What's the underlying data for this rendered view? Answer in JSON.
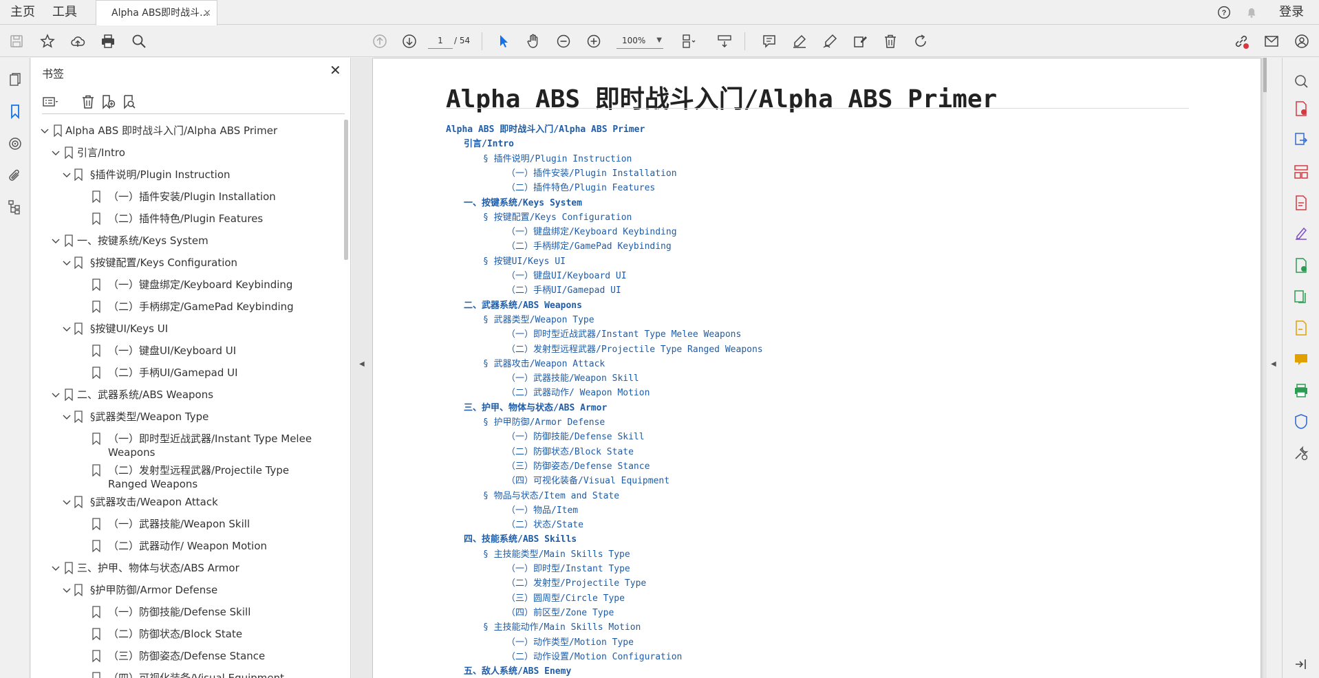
{
  "tabbar": {
    "home": "主页",
    "tools": "工具",
    "doc_tab": "Alpha ABS即时战斗...",
    "close": "×",
    "login": "登录"
  },
  "toolbar": {
    "page_current": "1",
    "page_total": "/ 54",
    "zoom": "100%"
  },
  "icons": {
    "save": "save-icon",
    "bookmark_star": "star-icon",
    "upload": "cloud-upload-icon",
    "print": "print-icon",
    "search": "search-icon",
    "prev_page": "arrow-up-circle-icon",
    "next_page": "arrow-down-circle-icon",
    "select": "cursor-icon",
    "hand": "hand-icon",
    "zoom_out": "zoom-out-icon",
    "zoom_in": "zoom-in-icon"
  },
  "panel": {
    "title": "书签",
    "close": "✕"
  },
  "bookmarks": [
    {
      "label": "Alpha ABS 即时战斗入门/Alpha ABS Primer",
      "level": 0,
      "expand": true
    },
    {
      "label": "引言/Intro",
      "level": 1,
      "expand": true
    },
    {
      "label": "§插件说明/Plugin Instruction",
      "level": 2,
      "expand": true
    },
    {
      "label": "（一）插件安装/Plugin Installation",
      "level": 3,
      "expand": false
    },
    {
      "label": "（二）插件特色/Plugin Features",
      "level": 3,
      "expand": false
    },
    {
      "label": "一、按键系统/Keys System",
      "level": 1,
      "expand": true
    },
    {
      "label": "§按键配置/Keys Configuration",
      "level": 2,
      "expand": true
    },
    {
      "label": "（一）键盘绑定/Keyboard Keybinding",
      "level": 3,
      "expand": false
    },
    {
      "label": "（二）手柄绑定/GamePad Keybinding",
      "level": 3,
      "expand": false
    },
    {
      "label": "§按键UI/Keys UI",
      "level": 2,
      "expand": true
    },
    {
      "label": "（一）键盘UI/Keyboard UI",
      "level": 3,
      "expand": false
    },
    {
      "label": "（二）手柄UI/Gamepad UI",
      "level": 3,
      "expand": false
    },
    {
      "label": "二、武器系统/ABS Weapons",
      "level": 1,
      "expand": true
    },
    {
      "label": "§武器类型/Weapon Type",
      "level": 2,
      "expand": true
    },
    {
      "label": "（一）即时型近战武器/Instant Type Melee Weapons",
      "level": 3,
      "expand": false
    },
    {
      "label": "（二）发射型远程武器/Projectile Type Ranged Weapons",
      "level": 3,
      "expand": false
    },
    {
      "label": "§武器攻击/Weapon Attack",
      "level": 2,
      "expand": true
    },
    {
      "label": "（一）武器技能/Weapon Skill",
      "level": 3,
      "expand": false
    },
    {
      "label": "（二）武器动作/ Weapon Motion",
      "level": 3,
      "expand": false
    },
    {
      "label": "三、护甲、物体与状态/ABS Armor",
      "level": 1,
      "expand": true
    },
    {
      "label": "§护甲防御/Armor Defense",
      "level": 2,
      "expand": true
    },
    {
      "label": "（一）防御技能/Defense Skill",
      "level": 3,
      "expand": false
    },
    {
      "label": "（二）防御状态/Block State",
      "level": 3,
      "expand": false
    },
    {
      "label": "（三）防御姿态/Defense Stance",
      "level": 3,
      "expand": false
    },
    {
      "label": "（四）可视化装备/Visual Equipment",
      "level": 3,
      "expand": false
    }
  ],
  "document": {
    "title": "Alpha ABS 即时战斗入门/Alpha ABS Primer",
    "toc": [
      {
        "text": "Alpha ABS 即时战斗入门/Alpha ABS Primer",
        "indent": 0,
        "bold": true
      },
      {
        "text": "引言/Intro",
        "indent": 1,
        "bold": true
      },
      {
        "text": "§ 插件说明/Plugin Instruction",
        "indent": 2,
        "bold": false
      },
      {
        "text": "（一）插件安装/Plugin Installation",
        "indent": 3,
        "bold": false
      },
      {
        "text": "（二）插件特色/Plugin Features",
        "indent": 3,
        "bold": false
      },
      {
        "text": "一、按键系统/Keys System",
        "indent": 1,
        "bold": true
      },
      {
        "text": "§ 按键配置/Keys Configuration",
        "indent": 2,
        "bold": false
      },
      {
        "text": "（一）键盘绑定/Keyboard Keybinding",
        "indent": 3,
        "bold": false
      },
      {
        "text": "（二）手柄绑定/GamePad Keybinding",
        "indent": 3,
        "bold": false
      },
      {
        "text": "§ 按键UI/Keys UI",
        "indent": 2,
        "bold": false
      },
      {
        "text": "（一）键盘UI/Keyboard UI",
        "indent": 3,
        "bold": false
      },
      {
        "text": "（二）手柄UI/Gamepad UI",
        "indent": 3,
        "bold": false
      },
      {
        "text": "二、武器系统/ABS Weapons",
        "indent": 1,
        "bold": true
      },
      {
        "text": "§ 武器类型/Weapon Type",
        "indent": 2,
        "bold": false
      },
      {
        "text": "（一）即时型近战武器/Instant Type Melee Weapons",
        "indent": 3,
        "bold": false
      },
      {
        "text": "（二）发射型远程武器/Projectile Type Ranged Weapons",
        "indent": 3,
        "bold": false
      },
      {
        "text": "§ 武器攻击/Weapon Attack",
        "indent": 2,
        "bold": false
      },
      {
        "text": "（一）武器技能/Weapon Skill",
        "indent": 3,
        "bold": false
      },
      {
        "text": "（二）武器动作/ Weapon Motion",
        "indent": 3,
        "bold": false
      },
      {
        "text": "三、护甲、物体与状态/ABS Armor",
        "indent": 1,
        "bold": true
      },
      {
        "text": "§ 护甲防御/Armor Defense",
        "indent": 2,
        "bold": false
      },
      {
        "text": "（一）防御技能/Defense Skill",
        "indent": 3,
        "bold": false
      },
      {
        "text": "（二）防御状态/Block State",
        "indent": 3,
        "bold": false
      },
      {
        "text": "（三）防御姿态/Defense Stance",
        "indent": 3,
        "bold": false
      },
      {
        "text": "（四）可视化装备/Visual Equipment",
        "indent": 3,
        "bold": false
      },
      {
        "text": "§ 物品与状态/Item and State",
        "indent": 2,
        "bold": false
      },
      {
        "text": "（一）物品/Item",
        "indent": 3,
        "bold": false
      },
      {
        "text": "（二）状态/State",
        "indent": 3,
        "bold": false
      },
      {
        "text": "四、技能系统/ABS Skills",
        "indent": 1,
        "bold": true
      },
      {
        "text": "§ 主技能类型/Main Skills Type",
        "indent": 2,
        "bold": false
      },
      {
        "text": "（一）即时型/Instant Type",
        "indent": 3,
        "bold": false
      },
      {
        "text": "（二）发射型/Projectile Type",
        "indent": 3,
        "bold": false
      },
      {
        "text": "（三）圆周型/Circle Type",
        "indent": 3,
        "bold": false
      },
      {
        "text": "（四）前区型/Zone Type",
        "indent": 3,
        "bold": false
      },
      {
        "text": "§ 主技能动作/Main Skills Motion",
        "indent": 2,
        "bold": false
      },
      {
        "text": "（一）动作类型/Motion Type",
        "indent": 3,
        "bold": false
      },
      {
        "text": "（二）动作设置/Motion Configuration",
        "indent": 3,
        "bold": false
      },
      {
        "text": "五、敌人系统/ABS Enemy",
        "indent": 1,
        "bold": true
      }
    ]
  },
  "colors": {
    "accent": "#1473e6",
    "link": "#1f5ca8",
    "right_tools": [
      "#d7373f",
      "#2f6bd7",
      "#d7373f",
      "#d7373f",
      "#7b4dc7",
      "#2e9b53",
      "#2e9b53",
      "#e0a000",
      "#e0a000",
      "#2e9b53",
      "#2f6bd7",
      "#555555"
    ]
  }
}
